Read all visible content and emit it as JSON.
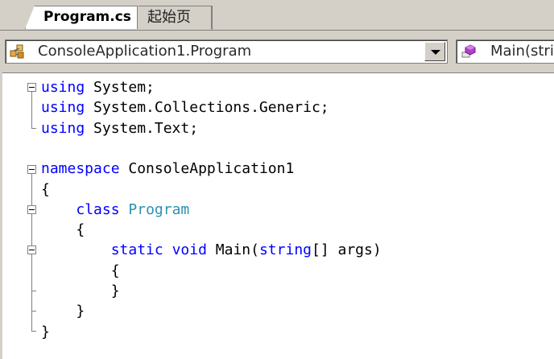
{
  "tabs": [
    {
      "label": "Program.cs",
      "active": true
    },
    {
      "label": "起始页",
      "active": false
    }
  ],
  "navigation": {
    "type_selector": {
      "value": "ConsoleApplication1.Program",
      "icon": "class-icon"
    },
    "member_selector": {
      "value": "Main(stri",
      "icon": "method-icon"
    }
  },
  "colors": {
    "keyword": "#0000ff",
    "type": "#2b91af",
    "text": "#000000"
  },
  "code": [
    {
      "line": 1,
      "tokens": [
        {
          "t": "using",
          "c": "kw"
        },
        {
          "t": " System;",
          "c": ""
        }
      ]
    },
    {
      "line": 2,
      "tokens": [
        {
          "t": "using",
          "c": "kw"
        },
        {
          "t": " System.Collections.Generic;",
          "c": ""
        }
      ]
    },
    {
      "line": 3,
      "tokens": [
        {
          "t": "using",
          "c": "kw"
        },
        {
          "t": " System.Text;",
          "c": ""
        }
      ]
    },
    {
      "line": 4,
      "tokens": []
    },
    {
      "line": 5,
      "tokens": [
        {
          "t": "namespace",
          "c": "kw"
        },
        {
          "t": " ConsoleApplication1",
          "c": ""
        }
      ]
    },
    {
      "line": 6,
      "tokens": [
        {
          "t": "{",
          "c": ""
        }
      ]
    },
    {
      "line": 7,
      "tokens": [
        {
          "t": "    ",
          "c": ""
        },
        {
          "t": "class",
          "c": "kw"
        },
        {
          "t": " ",
          "c": ""
        },
        {
          "t": "Program",
          "c": "ty"
        }
      ]
    },
    {
      "line": 8,
      "tokens": [
        {
          "t": "    {",
          "c": ""
        }
      ]
    },
    {
      "line": 9,
      "tokens": [
        {
          "t": "        ",
          "c": ""
        },
        {
          "t": "static",
          "c": "kw"
        },
        {
          "t": " ",
          "c": ""
        },
        {
          "t": "void",
          "c": "kw"
        },
        {
          "t": " Main(",
          "c": ""
        },
        {
          "t": "string",
          "c": "kw"
        },
        {
          "t": "[] args)",
          "c": ""
        }
      ]
    },
    {
      "line": 10,
      "tokens": [
        {
          "t": "        {",
          "c": ""
        }
      ]
    },
    {
      "line": 11,
      "tokens": [
        {
          "t": "        }",
          "c": ""
        }
      ]
    },
    {
      "line": 12,
      "tokens": [
        {
          "t": "    }",
          "c": ""
        }
      ]
    },
    {
      "line": 13,
      "tokens": [
        {
          "t": "}",
          "c": ""
        }
      ]
    }
  ]
}
